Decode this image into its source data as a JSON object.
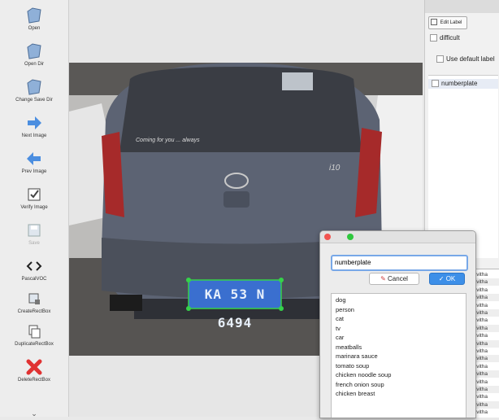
{
  "toolbar": {
    "items": [
      {
        "label": "Open",
        "icon": "folder-icon"
      },
      {
        "label": "Open Dir",
        "icon": "folder-icon"
      },
      {
        "label": "Change Save Dir",
        "icon": "folder-icon"
      },
      {
        "label": "Next Image",
        "icon": "arrow-right-icon"
      },
      {
        "label": "Prev Image",
        "icon": "arrow-left-icon"
      },
      {
        "label": "Verify Image",
        "icon": "checkbox-icon"
      },
      {
        "label": "Save",
        "icon": "save-icon"
      },
      {
        "label": "PascalVOC",
        "icon": "code-icon"
      },
      {
        "label": "CreateRectBox",
        "icon": "create-box-icon"
      },
      {
        "label": "DuplicateRectBox",
        "icon": "duplicate-icon"
      },
      {
        "label": "DeleteRectBox",
        "icon": "delete-x-icon"
      }
    ]
  },
  "image": {
    "plate_text": "KA 53 N 6494",
    "rear_glass_text": "Coming for you ... always",
    "badge_text": "i10"
  },
  "dock": {
    "edit_label": "Edit Label",
    "difficult": "difficult",
    "use_default_label": "Use default label",
    "label_item": "numberplate"
  },
  "file_list": [
    "pavitha",
    "pavitha",
    "pavitha",
    "pavitha",
    "pavitha",
    "pavitha",
    "pavitha",
    "pavitha",
    "pavitha",
    "pavitha",
    "pavitha",
    "pavitha",
    "pavitha",
    "pavitha",
    "pavitha",
    "pavitha",
    "pavitha",
    "pavitha",
    "pavitha"
  ],
  "dialog": {
    "input_value": "numberplate",
    "cancel_label": "Cancel",
    "ok_label": "OK",
    "options": [
      "dog",
      "person",
      "cat",
      "tv",
      "car",
      "meatballs",
      "marinara sauce",
      "tomato soup",
      "chicken noodle soup",
      "french onion soup",
      "chicken breast"
    ]
  },
  "colors": {
    "accent": "#3d8fe8",
    "bbox": "#35d24a",
    "plate_bg": "#3a6fcf"
  }
}
